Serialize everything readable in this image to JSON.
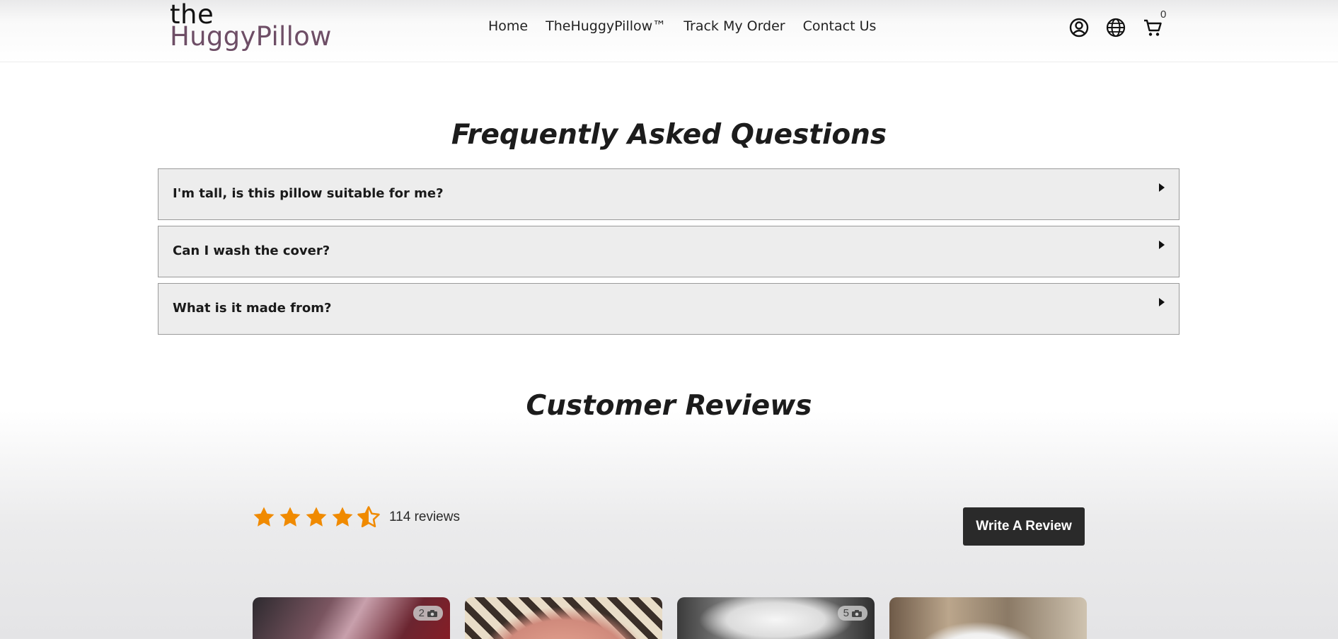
{
  "header": {
    "logo_the": "the",
    "logo_brand": "HuggyPillow",
    "nav": [
      {
        "label": "Home"
      },
      {
        "label": "TheHuggyPillow™"
      },
      {
        "label": "Track My Order"
      },
      {
        "label": "Contact Us"
      }
    ],
    "icons": [
      "account-icon",
      "globe-icon",
      "cart-icon"
    ],
    "cart_count": "0"
  },
  "faq": {
    "title": "Frequently Asked Questions",
    "items": [
      {
        "question": "I'm tall, is this pillow suitable for me?"
      },
      {
        "question": "Can I wash the cover?"
      },
      {
        "question": "What is it made from?"
      }
    ]
  },
  "reviews": {
    "title": "Customer Reviews",
    "rating": 4.5,
    "count_label": "114 reviews",
    "write_button": "Write A Review",
    "star_color": "#f08a00",
    "photos": [
      {
        "badge": "2",
        "icon": "camera-icon"
      },
      {
        "badge": "",
        "icon": ""
      },
      {
        "badge": "5",
        "icon": "camera-icon"
      },
      {
        "badge": "",
        "icon": ""
      }
    ]
  },
  "colors": {
    "brand_purple": "#6e4e66",
    "button_dark": "#2a2a2a",
    "faq_bg": "#ededed"
  }
}
